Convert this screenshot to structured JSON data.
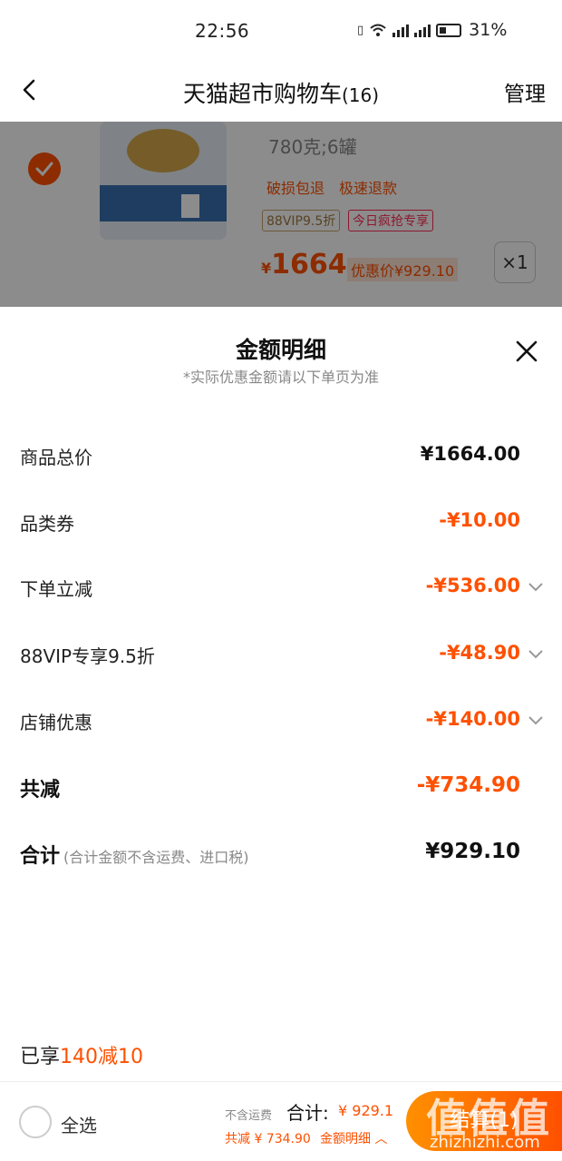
{
  "status_bar": {
    "time": "22:56",
    "battery": "31%"
  },
  "nav": {
    "title": "天猫超市购物车",
    "count": "(16)",
    "manage_label": "管理"
  },
  "product": {
    "variant": "780克;6罐",
    "tags": [
      "破损包退",
      "极速退款"
    ],
    "badge_vip": "88VIP9.5折",
    "badge_today": "今日疯抢专享",
    "price_symbol": "¥",
    "price": "1664",
    "promo_price": "优惠价¥929.10",
    "quantity": "×1",
    "selected": true
  },
  "modal": {
    "title": "金额明细",
    "subtitle": "*实际优惠金额请以下单页为准",
    "rows": [
      {
        "label": "商品总价",
        "value": "¥1664.00"
      },
      {
        "label": "品类券",
        "value": "-¥10.00"
      },
      {
        "label": "下单立减",
        "value": "-¥536.00"
      },
      {
        "label": "88VIP专享9.5折",
        "value": "-¥48.90"
      },
      {
        "label": "店铺优惠",
        "value": "-¥140.00"
      }
    ],
    "total_saved": {
      "label": "共减",
      "value": "-¥734.90"
    },
    "total": {
      "label": "合计",
      "note": "(合计金额不含运费、进口税)",
      "value": "¥929.10"
    },
    "enjoyed_prefix": "已享",
    "enjoyed_highlight": "140减10"
  },
  "bottom_bar": {
    "select_all": "全选",
    "no_shipping": "不含运费",
    "total_label": "合计:",
    "total_value": "¥ 929.1",
    "saved": "共减 ¥ 734.90",
    "detail_link": "金额明细",
    "checkout": "结算(1)"
  },
  "colors": {
    "accent": "#ff5000",
    "mask": "rgba(0,0,0,0.45)"
  }
}
